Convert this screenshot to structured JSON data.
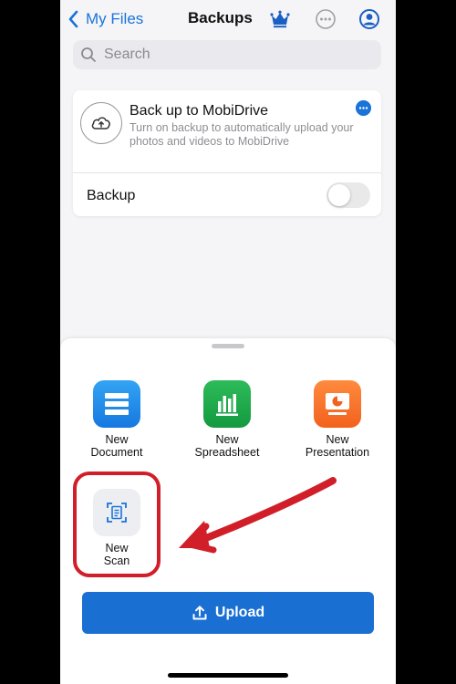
{
  "nav": {
    "back_label": "My Files",
    "title": "Backups"
  },
  "search": {
    "placeholder": "Search"
  },
  "backup_card": {
    "title": "Back up to MobiDrive",
    "description": "Turn on backup to automatically upload your photos and videos to MobiDrive",
    "toggle_label": "Backup",
    "toggle_on": false
  },
  "sheet": {
    "items": [
      {
        "label_line1": "New",
        "label_line2": "Document",
        "icon": "document-icon"
      },
      {
        "label_line1": "New",
        "label_line2": "Spreadsheet",
        "icon": "spreadsheet-icon"
      },
      {
        "label_line1": "New",
        "label_line2": "Presentation",
        "icon": "presentation-icon"
      },
      {
        "label_line1": "New",
        "label_line2": "Scan",
        "icon": "scan-icon"
      }
    ],
    "upload_label": "Upload"
  },
  "colors": {
    "accent": "#1a73d9",
    "upload_button": "#1a6fd3",
    "annotation": "#d11f2a"
  }
}
